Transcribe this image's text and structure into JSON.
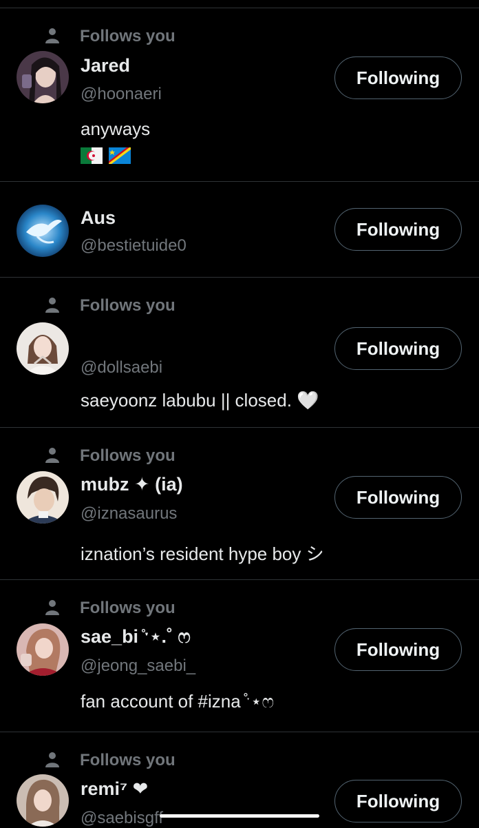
{
  "follow_label": "Following",
  "follows_you_label": "Follows you",
  "colors": {
    "background": "#000000",
    "primary_text": "#e7e9ea",
    "secondary_text": "#71767b",
    "divider": "#2f3336",
    "button_border": "#536471"
  },
  "users": [
    {
      "name": "Jared",
      "handle": "@hoonaeri",
      "bio": "anyways",
      "bio_extra": [
        "flag-algeria-icon",
        "flag-dr-congo-icon"
      ],
      "follows_you": true,
      "button": "Following"
    },
    {
      "name": "Aus",
      "handle": "@bestietuide0",
      "bio": "",
      "follows_you": false,
      "button": "Following"
    },
    {
      "name": "",
      "handle": "@dollsaebi",
      "bio": "saeyoonz labubu || closed. 🤍",
      "follows_you": true,
      "button": "Following"
    },
    {
      "name": "mubz ✦ (ia)",
      "handle": "@iznasaurus",
      "bio": "iznation’s resident hype boy シ",
      "follows_you": true,
      "button": "Following"
    },
    {
      "name": "sae_bi ̊ˑ⋆.˚ ෆ",
      "handle": "@jeong_saebi_",
      "bio": "fan account of #izna ̊ˑ⋆ෆ",
      "follows_you": true,
      "button": "Following"
    },
    {
      "name": "remi⁷ ❤",
      "handle": "@saebisgff",
      "bio": "",
      "follows_you": true,
      "button": "Following"
    }
  ]
}
